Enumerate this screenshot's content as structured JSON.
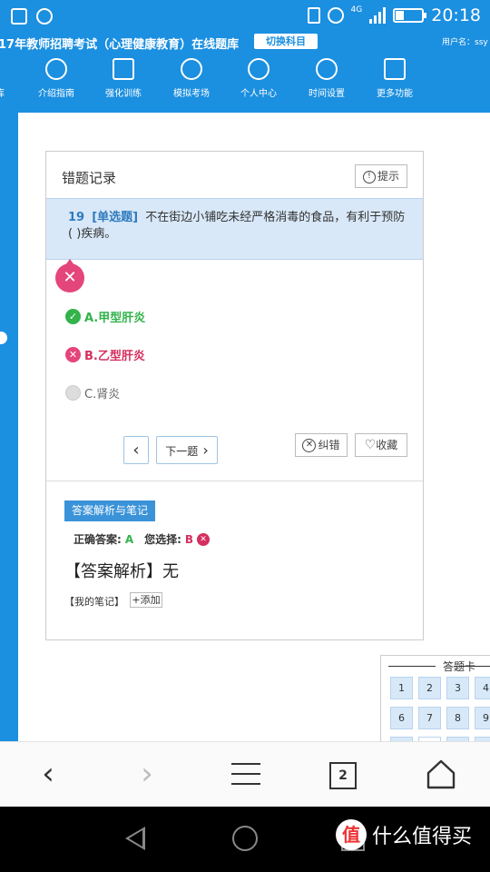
{
  "status_bar": {
    "network": "4G",
    "time": "20:18"
  },
  "header": {
    "title": "17年教师招聘考试（心理健康教育）在线题库",
    "switch_subject": "切换科目",
    "user_label": "用户名：ssy",
    "nav": [
      {
        "label": "库",
        "icon": "library-icon"
      },
      {
        "label": "介绍指南",
        "icon": "compass-icon"
      },
      {
        "label": "强化训练",
        "icon": "edit-icon"
      },
      {
        "label": "模拟考场",
        "icon": "clock-icon"
      },
      {
        "label": "个人中心",
        "icon": "user-icon"
      },
      {
        "label": "时间设置",
        "icon": "gear-icon"
      },
      {
        "label": "更多功能",
        "icon": "grid-icon"
      }
    ]
  },
  "panel": {
    "title": "错题记录",
    "hint_label": "提示",
    "question": {
      "number": "19",
      "type": "[单选题]",
      "text": "不在街边小铺吃未经严格消毒的食品，有利于预防( )疾病。"
    },
    "options": [
      {
        "label": "A.甲型肝炎",
        "state": "correct"
      },
      {
        "label": "B.乙型肝炎",
        "state": "wrong"
      },
      {
        "label": "C.肾炎",
        "state": "none"
      }
    ],
    "prev_label": "‹",
    "next_label": "下一题",
    "correct_error_label": "纠错",
    "favorite_label": "收藏",
    "analysis_tag": "答案解析与笔记",
    "correct_answer_label": "正确答案:",
    "correct_answer": "A",
    "your_choice_label": "您选择:",
    "your_choice": "B",
    "analysis_text": "【答案解析】无",
    "notes_label": "【我的笔记】",
    "add_label": "+添加"
  },
  "answer_card": {
    "title": "答题卡",
    "cells": [
      "1",
      "2",
      "3",
      "4",
      "6",
      "7",
      "8",
      "9"
    ]
  },
  "browser_bar": {
    "tab_count": "2"
  },
  "watermark": {
    "text": "什么值得买",
    "logo": "值"
  }
}
